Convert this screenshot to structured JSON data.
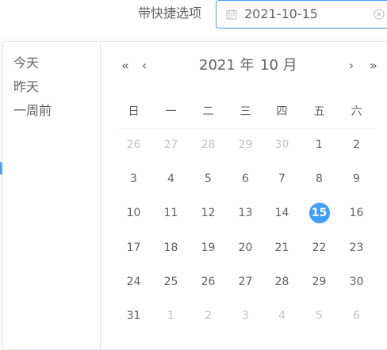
{
  "form": {
    "label": "带快捷选项",
    "value": "2021-10-15"
  },
  "icons": {
    "input_prefix": "calendar-icon",
    "input_suffix": "circle-close-icon",
    "prev_year": "double-arrow-left-icon",
    "prev_month": "arrow-left-icon",
    "next_month": "arrow-right-icon",
    "next_year": "double-arrow-right-icon"
  },
  "shortcuts": [
    "今天",
    "昨天",
    "一周前"
  ],
  "header": {
    "year": "2021 年",
    "month": "10 月"
  },
  "weekdays": [
    "日",
    "一",
    "二",
    "三",
    "四",
    "五",
    "六"
  ],
  "weeks": [
    [
      "26",
      "27",
      "28",
      "29",
      "30",
      "1",
      "2"
    ],
    [
      "3",
      "4",
      "5",
      "6",
      "7",
      "8",
      "9"
    ],
    [
      "10",
      "11",
      "12",
      "13",
      "14",
      "15",
      "16"
    ],
    [
      "17",
      "18",
      "19",
      "20",
      "21",
      "22",
      "23"
    ],
    [
      "24",
      "25",
      "26",
      "27",
      "28",
      "29",
      "30"
    ],
    [
      "31",
      "1",
      "2",
      "3",
      "4",
      "5",
      "6"
    ]
  ],
  "selected_day": "15",
  "colors": {
    "accent": "#409eff",
    "text": "#606266",
    "muted": "#c0c4cc",
    "border": "#e4e7ed"
  }
}
